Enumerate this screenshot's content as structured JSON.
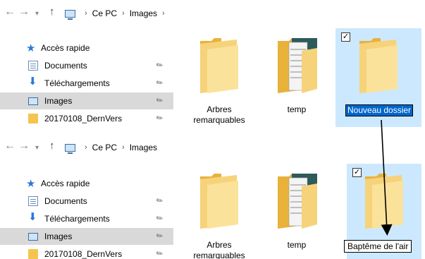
{
  "panels": [
    {
      "breadcrumb": [
        "Ce PC",
        "Images"
      ],
      "quick_access": "Accès rapide",
      "nav_items": [
        {
          "label": "Documents",
          "icon": "document-icon",
          "pinned": true
        },
        {
          "label": "Téléchargements",
          "icon": "download-arrow-icon",
          "pinned": true
        },
        {
          "label": "Images",
          "icon": "pictures-icon",
          "pinned": true,
          "selected": true
        },
        {
          "label": "20170108_DernVers",
          "icon": "folder-icon",
          "pinned": true
        }
      ],
      "files": [
        {
          "name": "Arbres remarquables",
          "type": "folder"
        },
        {
          "name": "temp",
          "type": "folder-with-content"
        },
        {
          "name": "Nouveau dossier",
          "type": "folder",
          "selected": true,
          "editing": true
        }
      ]
    },
    {
      "breadcrumb": [
        "Ce PC",
        "Images"
      ],
      "quick_access": "Accès rapide",
      "nav_items": [
        {
          "label": "Documents",
          "icon": "document-icon",
          "pinned": true
        },
        {
          "label": "Téléchargements",
          "icon": "download-arrow-icon",
          "pinned": true
        },
        {
          "label": "Images",
          "icon": "pictures-icon",
          "pinned": true,
          "selected": true
        },
        {
          "label": "20170108_DernVers",
          "icon": "folder-icon",
          "pinned": true
        }
      ],
      "files": [
        {
          "name": "Arbres remarquables",
          "type": "folder"
        },
        {
          "name": "temp",
          "type": "folder-with-content"
        },
        {
          "name": "Baptême de l'air",
          "type": "folder",
          "selected": true,
          "editing": true
        }
      ]
    }
  ],
  "colors": {
    "selection_bg": "#cce8ff",
    "nav_selected_bg": "#d9d9d9",
    "rename_highlight": "#0066cc",
    "folder_yellow": "#f4c54e"
  }
}
